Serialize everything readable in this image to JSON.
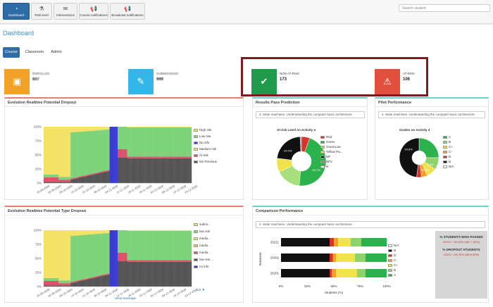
{
  "nav": [
    {
      "label": "Dashboard",
      "icon": "dashboard-icon",
      "glyph": "◔",
      "active": true
    },
    {
      "label": "Risk level",
      "icon": "flask-icon",
      "glyph": "⚗",
      "active": false
    },
    {
      "label": "Interventions",
      "icon": "envelope-icon",
      "glyph": "✉",
      "active": false
    },
    {
      "label": "Course notifications",
      "icon": "megaphone-icon",
      "glyph": "📢",
      "active": false
    },
    {
      "label": "Broadcast notifications",
      "icon": "megaphone-icon",
      "glyph": "📢",
      "active": false
    }
  ],
  "search": {
    "placeholder": "Search student"
  },
  "page_title": "Dashboard",
  "tabs": [
    {
      "label": "Course",
      "active": true
    },
    {
      "label": "Classroom",
      "active": false
    },
    {
      "label": "Admin",
      "active": false
    }
  ],
  "stats": [
    {
      "title": "ENROLLED",
      "value": "607",
      "color": "#f2a127",
      "icon": "briefcase-icon",
      "glyph": "▣",
      "blurred": true
    },
    {
      "title": "SUBMISSIONS",
      "value": "999",
      "color": "#33b7e8",
      "icon": "edit-icon",
      "glyph": "✎",
      "blurred": true
    },
    {
      "title": "NON AT-RISK",
      "value": "173",
      "color": "#1f9a4b",
      "icon": "check-circle-icon",
      "glyph": "✔"
    },
    {
      "title": "AT-RISK",
      "value": "106",
      "color": "#e0503c",
      "icon": "warning-icon",
      "glyph": "⚠"
    }
  ],
  "panels": {
    "dropout": "Evolution Realtime Potential Dropout",
    "type_dropout": "Evolution Realtime Potential Type Dropout",
    "pass_prediction": "Results Pass Prediction",
    "pilot": "Pilot Performance",
    "comparison": "Comparison Performance"
  },
  "selects": {
    "pass": "4. State machines. Understanding the computer basic architecture",
    "pilot": "4. State machines. Understanding the computer basic architecture",
    "comparison": "4. State machines. Understanding the computer basic architecture"
  },
  "dropout_chart": {
    "y_ticks": [
      "100%",
      "75%",
      "50%",
      "25%",
      "0%"
    ],
    "x_ticks": [
      "25-09-2020",
      "02-09-2020",
      "09-10-2020",
      "14-10-2020",
      "21-10-2020",
      "28-10-2020",
      "04-11-2020",
      "11-11-2020",
      "18-11-2020",
      "25-11-2020",
      "02-12-2020",
      "09-12-2020",
      "16-12-2020",
      "23-12-2020"
    ],
    "legend": [
      {
        "label": "High risk",
        "color": "#f4e266"
      },
      {
        "label": "Low risk",
        "color": "#7dd37a"
      },
      {
        "label": "No info",
        "color": "#3b3bd4"
      },
      {
        "label": "Medium risk",
        "color": "#f4e266"
      },
      {
        "label": "At-risk",
        "color": "#e0506a"
      },
      {
        "label": "NS Previous",
        "color": "#555555"
      }
    ]
  },
  "type_chart": {
    "legend": [
      {
        "label": "submi...",
        "color": "#f4e266"
      },
      {
        "label": "low risk",
        "color": "#7dd37a"
      },
      {
        "label": "mediu...",
        "color": "#f4e266"
      },
      {
        "label": "mediu...",
        "color": "#f2c14e"
      },
      {
        "label": "mediu...",
        "color": "#e0506a"
      },
      {
        "label": "low resi...",
        "color": "#555555"
      },
      {
        "label": "no info",
        "color": "#3b3bd4"
      }
    ],
    "pager": "1/2",
    "send_message": "Send message"
  },
  "pass_chart": {
    "title": "At-risk Level on Activity 4",
    "legend": [
      {
        "label": "Red",
        "color": "#d8312a"
      },
      {
        "label": "Green",
        "color": "#2bb24c"
      },
      {
        "label": "GreenLow",
        "color": "#a7e07a"
      },
      {
        "label": "Yellow Pa...",
        "color": "#f0e24a"
      },
      {
        "label": "NP",
        "color": "#111111"
      },
      {
        "label": "NP2",
        "color": "#8a8a8a"
      },
      {
        "label": "N",
        "color": "#ffffff"
      }
    ],
    "slices": [
      6,
      50.7,
      18,
      10,
      24.4,
      1
    ],
    "slice_colors": [
      "#d8312a",
      "#2bb24c",
      "#a7e07a",
      "#f0e24a",
      "#111111",
      "#8a8a8a"
    ],
    "labels": [
      "24.4%",
      "50.7%"
    ]
  },
  "pilot_chart": {
    "title": "Grades on Activity 4",
    "legend": [
      {
        "label": "A",
        "color": "#2bb24c"
      },
      {
        "label": "B",
        "color": "#8bd36a"
      },
      {
        "label": "C+",
        "color": "#f0e24a"
      },
      {
        "label": "C-",
        "color": "#f2a127"
      },
      {
        "label": "D",
        "color": "#d8312a"
      },
      {
        "label": "N",
        "color": "#111111"
      },
      {
        "label": "N/A",
        "color": "#ffffff"
      }
    ],
    "slices": [
      25,
      10,
      8,
      5,
      4,
      48
    ],
    "slice_colors": [
      "#2bb24c",
      "#8bd36a",
      "#f0e24a",
      "#f2a127",
      "#d8312a",
      "#111111"
    ],
    "labels": [
      "24.6%",
      "9.4%",
      "41.0%"
    ]
  },
  "comparison": {
    "y_label": "Semester",
    "x_label": "Students (%)",
    "rows": [
      "20211",
      "20202",
      "20201"
    ],
    "x_ticks": [
      "0%",
      "25%",
      "50%",
      "75%",
      "100%"
    ],
    "legend": [
      {
        "label": "N/A",
        "color": "#ffffff"
      },
      {
        "label": "N",
        "color": "#111111"
      },
      {
        "label": "D",
        "color": "#d8312a"
      },
      {
        "label": "C-",
        "color": "#f2a127"
      },
      {
        "label": "C+",
        "color": "#f0e24a"
      },
      {
        "label": "B",
        "color": "#8bd36a"
      },
      {
        "label": "A",
        "color": "#2bb24c"
      }
    ],
    "data": [
      [
        0,
        46,
        4,
        4,
        12,
        10,
        24
      ],
      [
        0,
        46,
        3,
        3,
        18,
        10,
        20
      ],
      [
        0,
        46,
        2,
        4,
        20,
        8,
        20
      ]
    ],
    "side": {
      "passed_title": "% STUDENTS WHO PASSED",
      "passed_value": "20202: +40.39% (diff:-7.69%)",
      "dropout_title": "% DROPOUT STUDENTS",
      "dropout_value": "20202: +48.78% (diff:9.53%)"
    }
  }
}
